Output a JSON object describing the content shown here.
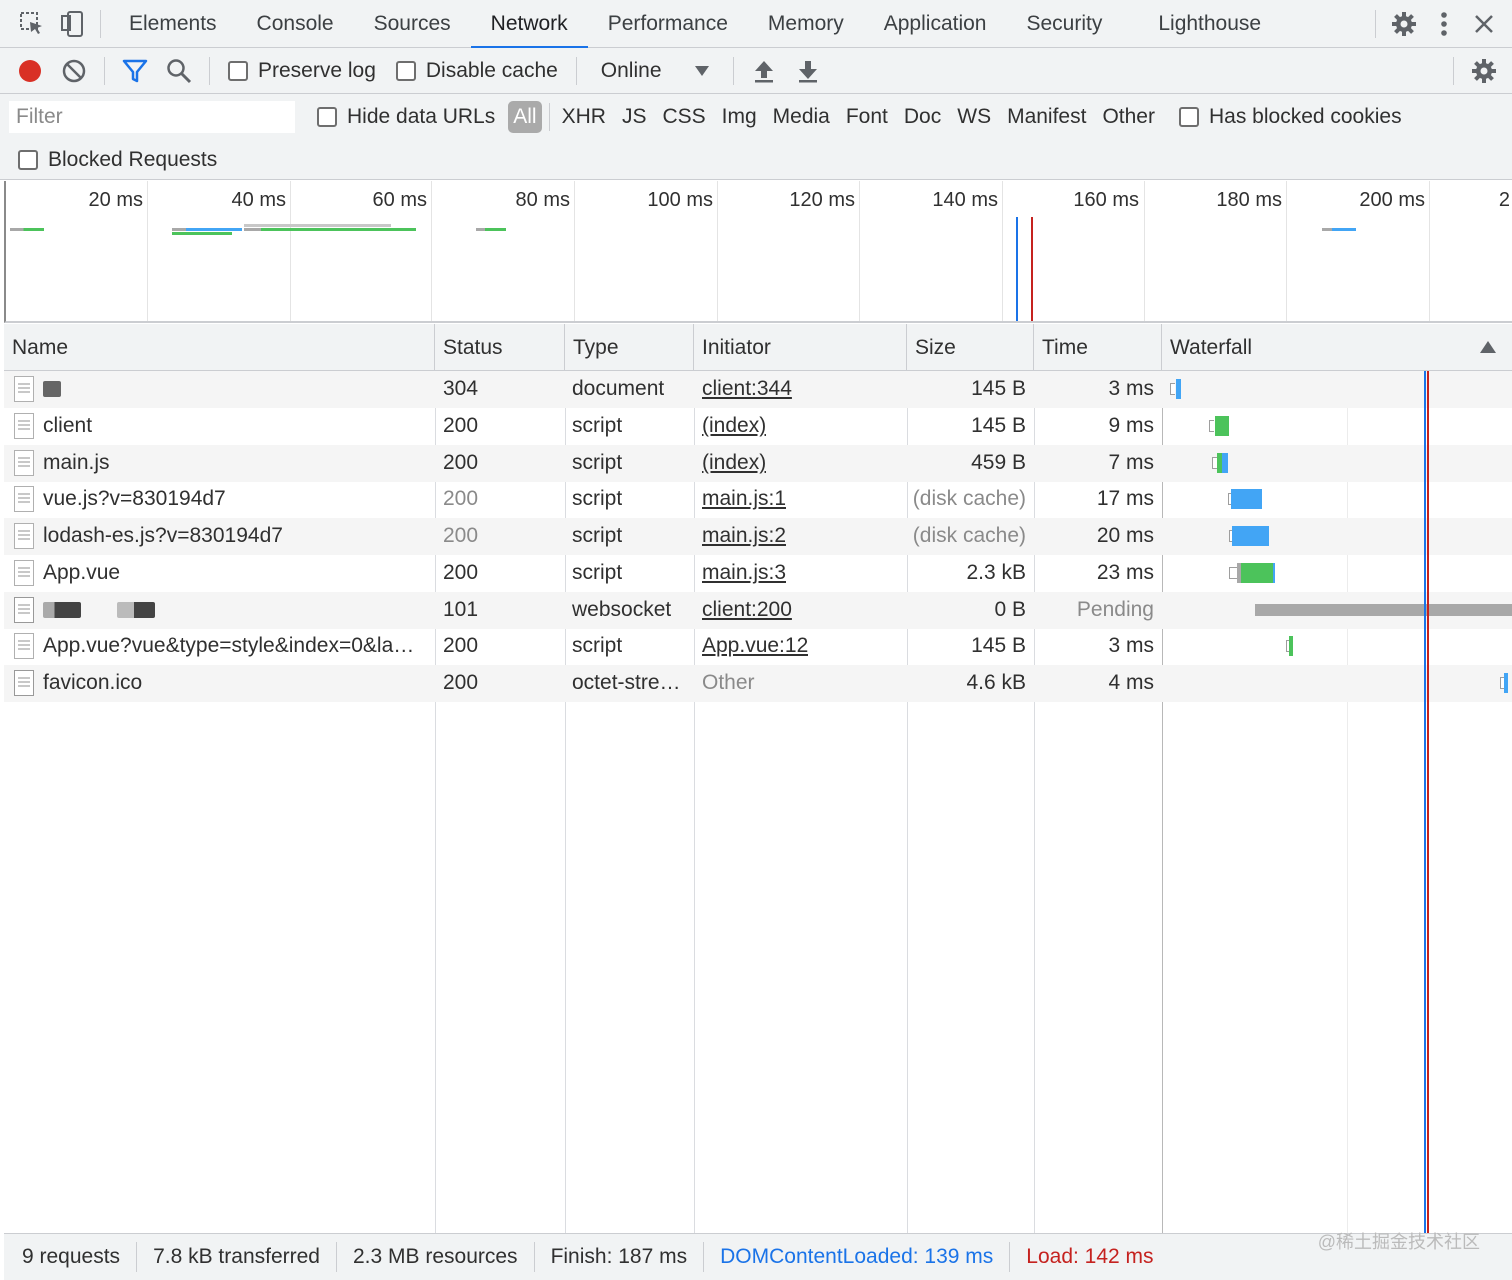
{
  "tabs": [
    "Elements",
    "Console",
    "Sources",
    "Network",
    "Performance",
    "Memory",
    "Application",
    "Security",
    "Lighthouse"
  ],
  "active_tab": "Network",
  "toolbar": {
    "preserve_log": "Preserve log",
    "disable_cache": "Disable cache",
    "throttle": "Online"
  },
  "filter": {
    "placeholder": "Filter",
    "hide_data_urls": "Hide data URLs",
    "types": [
      "All",
      "XHR",
      "JS",
      "CSS",
      "Img",
      "Media",
      "Font",
      "Doc",
      "WS",
      "Manifest",
      "Other"
    ],
    "active_type": "All",
    "has_blocked_cookies": "Has blocked cookies",
    "blocked_requests": "Blocked Requests"
  },
  "overview": {
    "tick_labels": [
      "20 ms",
      "40 ms",
      "60 ms",
      "80 ms",
      "100 ms",
      "120 ms",
      "140 ms",
      "160 ms",
      "180 ms",
      "200 ms",
      "2"
    ]
  },
  "columns": {
    "name": "Name",
    "status": "Status",
    "type": "Type",
    "initiator": "Initiator",
    "size": "Size",
    "time": "Time",
    "waterfall": "Waterfall"
  },
  "rows": [
    {
      "name": "",
      "status": "304",
      "type": "document",
      "initiator": "client:344",
      "size": "145 B",
      "time": "3 ms"
    },
    {
      "name": "client",
      "status": "200",
      "type": "script",
      "initiator": "(index)",
      "size": "145 B",
      "time": "9 ms"
    },
    {
      "name": "main.js",
      "status": "200",
      "type": "script",
      "initiator": "(index)",
      "size": "459 B",
      "time": "7 ms"
    },
    {
      "name": "vue.js?v=830194d7",
      "status": "200",
      "type": "script",
      "initiator": "main.js:1",
      "size": "(disk cache)",
      "time": "17 ms"
    },
    {
      "name": "lodash-es.js?v=830194d7",
      "status": "200",
      "type": "script",
      "initiator": "main.js:2",
      "size": "(disk cache)",
      "time": "20 ms"
    },
    {
      "name": "App.vue",
      "status": "200",
      "type": "script",
      "initiator": "main.js:3",
      "size": "2.3 kB",
      "time": "23 ms"
    },
    {
      "name": "",
      "status": "101",
      "type": "websocket",
      "initiator": "client:200",
      "size": "0 B",
      "time": "Pending"
    },
    {
      "name": "App.vue?vue&type=style&index=0&la…",
      "status": "200",
      "type": "script",
      "initiator": "App.vue:12",
      "size": "145 B",
      "time": "3 ms"
    },
    {
      "name": "favicon.ico",
      "status": "200",
      "type": "octet-stre…",
      "initiator": "Other",
      "size": "4.6 kB",
      "time": "4 ms"
    }
  ],
  "status_bar": {
    "requests": "9 requests",
    "transferred": "7.8 kB transferred",
    "resources": "2.3 MB resources",
    "finish": "Finish: 187 ms",
    "dom_content_loaded": "DOMContentLoaded: 139 ms",
    "load": "Load: 142 ms"
  },
  "watermark": "@稀土掘金技术社区",
  "colors": {
    "accent": "#1a73e8",
    "record": "#d93025",
    "load_line": "#c5221f",
    "dcl_line": "#1a73e8",
    "bar_green": "#4cc35b",
    "bar_blue": "#42a5f5",
    "bar_grey": "#a8a8a8"
  }
}
